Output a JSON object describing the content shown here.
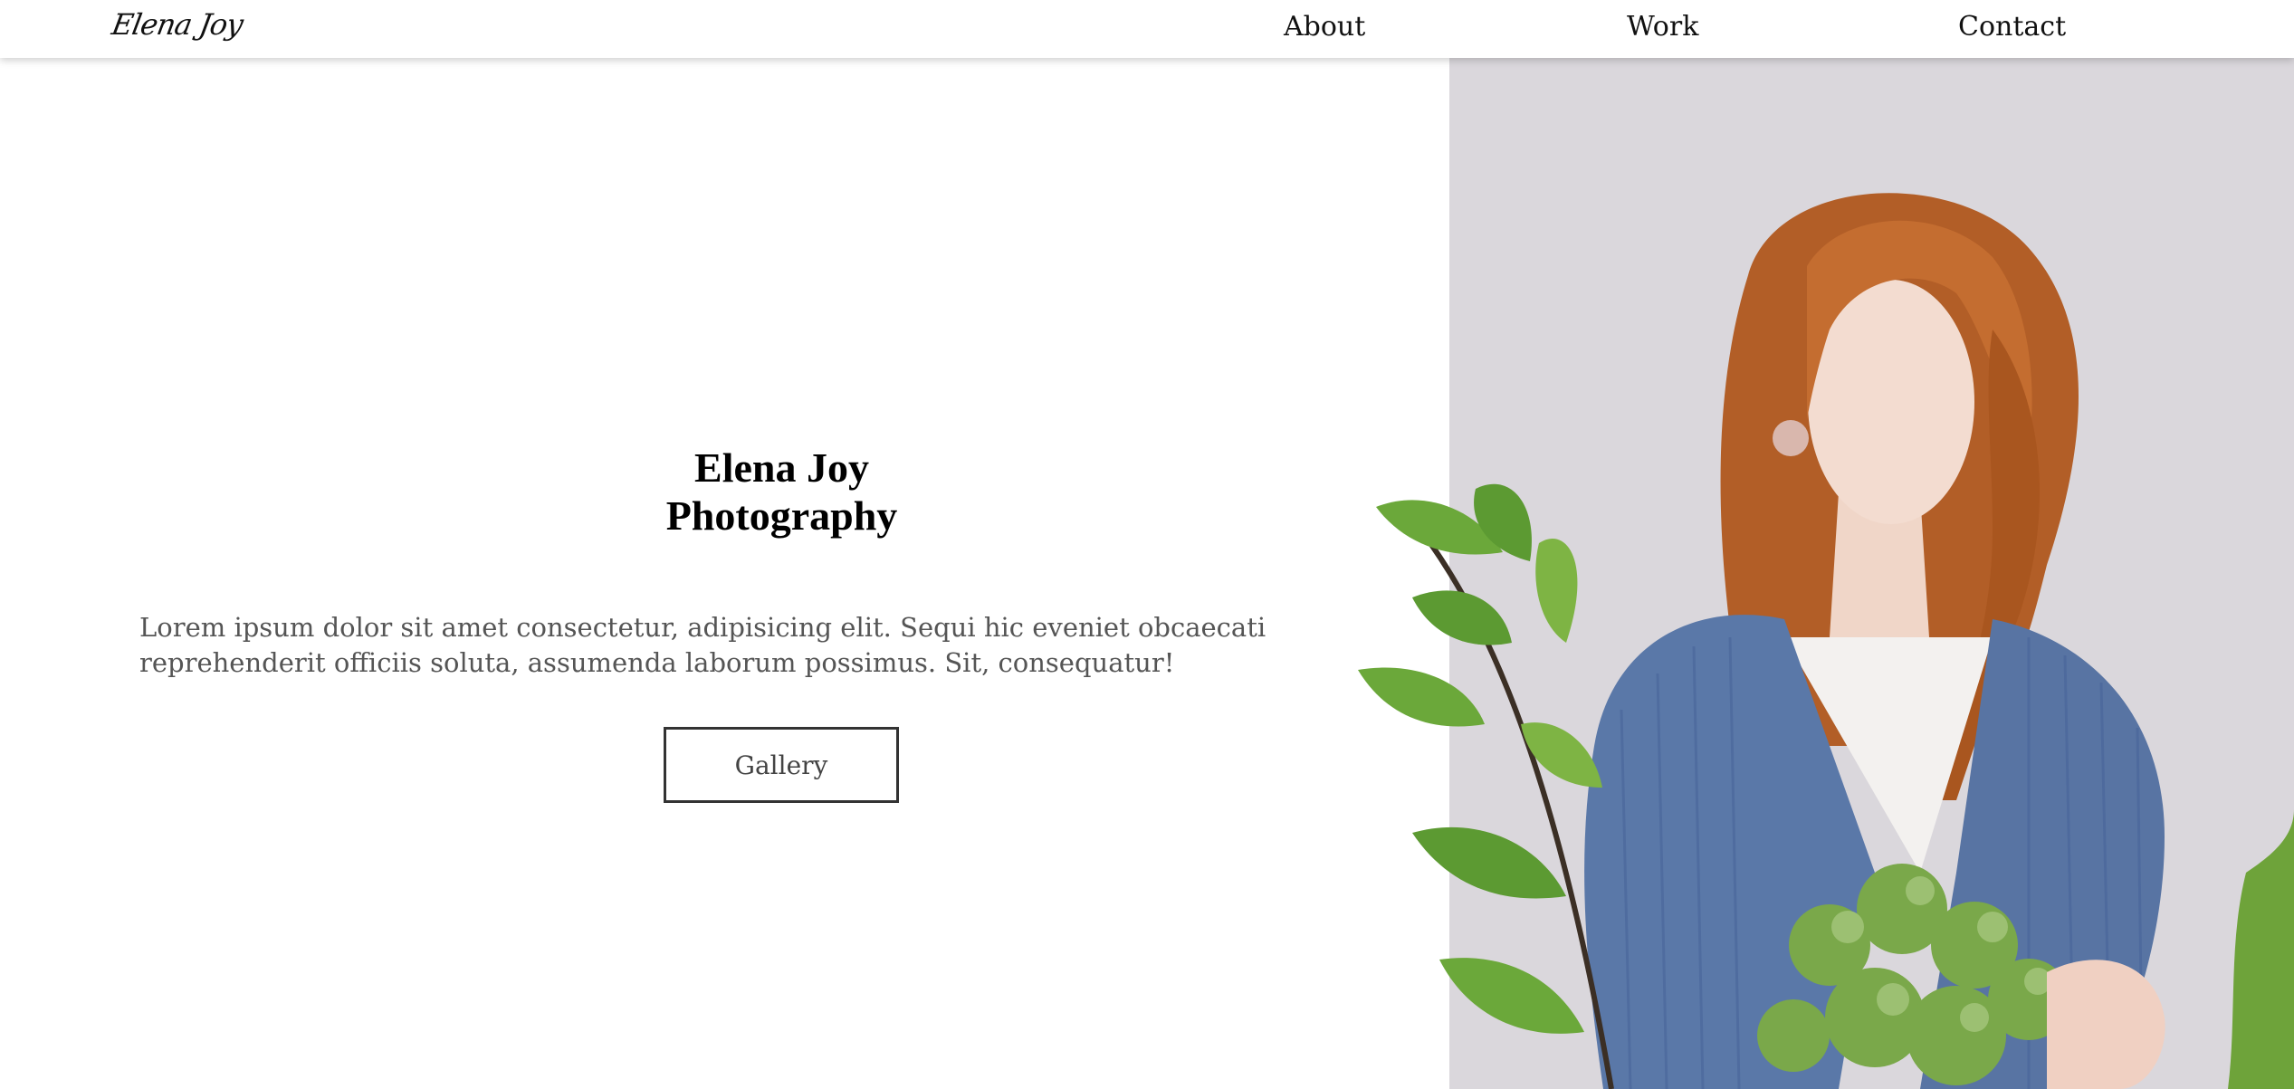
{
  "nav": {
    "logo": "Elena Joy",
    "links": [
      {
        "label": "About"
      },
      {
        "label": "Work"
      },
      {
        "label": "Contact"
      }
    ]
  },
  "hero": {
    "title_line1": "Elena Joy",
    "title_line2": "Photography",
    "text": "Lorem ipsum dolor sit amet consectetur, adipisicing elit. Sequi hic eveniet obcaecati reprehenderit officiis soluta, assumenda laborum possimus. Sit, consequatur!",
    "button_label": "Gallery"
  },
  "colors": {
    "background": "#ffffff",
    "image_background": "#dad7dc",
    "hair": "#b8622a",
    "sweater": "#5a78a8",
    "leaves": "#6fa43c"
  },
  "image": {
    "subject": "photo of a red-haired woman in a blue knit cardigan holding green flowers"
  }
}
